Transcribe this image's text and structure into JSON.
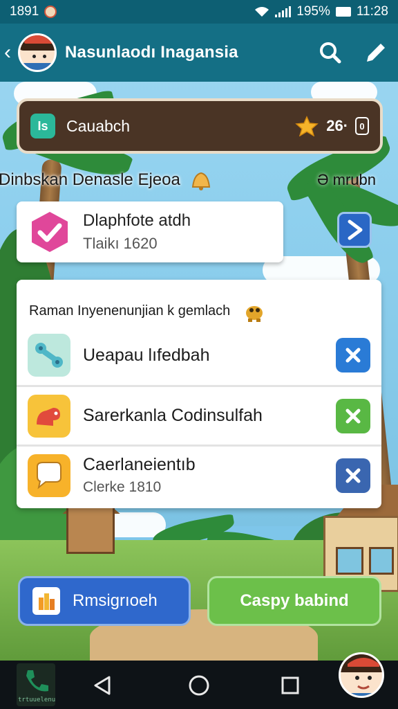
{
  "status_bar": {
    "time_left": "1891",
    "battery": "195%",
    "time": "11:28"
  },
  "app_bar": {
    "title": "Nasunlaodı Inagansia",
    "back_icon": "back-arrow-icon",
    "search_icon": "search-icon",
    "edit_icon": "pencil-icon"
  },
  "search_panel": {
    "chip": "Is",
    "label": "Cauabch",
    "score": "26·",
    "badge": "0"
  },
  "section": {
    "title": "Dinbskan Denasle Ejeoa",
    "link": "Ə mrubn"
  },
  "task_card": {
    "title": "Dlaphfote atdh",
    "subtitle": "Tlaikı 1620"
  },
  "list": {
    "header": "Raman Inyenenunjian k gemlach",
    "items": [
      {
        "title": "Ueapau lıfedbah",
        "subtitle": "",
        "icon": "wrench-icon",
        "icon_bg": "#bde8dd",
        "button_color": "#2a7bd6"
      },
      {
        "title": "Sarerkanla Codinsulfah",
        "subtitle": "",
        "icon": "dino-icon",
        "icon_bg": "#f7c33a",
        "button_color": "#59b844"
      },
      {
        "title": "Caerlaneientıb",
        "subtitle": "Clerke 1810",
        "icon": "chat-bubble-icon",
        "icon_bg": "#f7b22a",
        "button_color": "#3a66b0"
      }
    ]
  },
  "actions": {
    "primary_label": "Rmsigrıoeh",
    "secondary_label": "Caspy babind"
  },
  "nav_bar": {
    "logo_text": "trtuuelenu"
  },
  "colors": {
    "status_bar": "#0d5f73",
    "app_bar": "#146f85",
    "panel_brown": "#4a3425",
    "primary": "#2f68cc",
    "success": "#6cc04a"
  }
}
